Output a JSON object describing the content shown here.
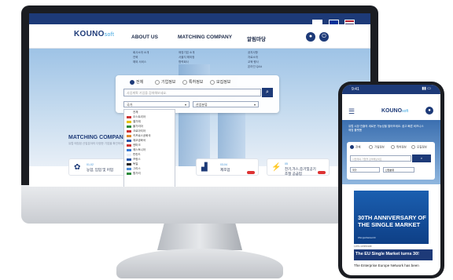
{
  "site": {
    "logo": "KOUNO",
    "logo_suffix": "soft",
    "nav": [
      "ABOUT US",
      "MATCHING COMPANY",
      "알림마당"
    ],
    "submenu_col1": [
      "회사소개 소개",
      "연혁",
      "해외 서비스"
    ],
    "submenu_col2": [
      "매칭기업 소개",
      "서울지 해외정",
      "협력회사"
    ],
    "submenu_col3": [
      "공지사항",
      "자료소개",
      "교육 행사",
      "온라인 Q&A"
    ],
    "search_tabs": [
      "전체",
      "기업정보",
      "특허정보",
      "모집정보"
    ],
    "search_placeholder": "사업계획 기업을 검색해보세요.",
    "search_icon_glyph": "⌕",
    "select_country": "국가",
    "select_industry": "산업분류",
    "dropdown_header": "전체",
    "dropdown_items": [
      "오스트리아",
      "벨기에",
      "불가리아",
      "크로아티아",
      "키프로스공화국",
      "체코공화국",
      "덴마크",
      "에스토니아",
      "핀란드",
      "프랑스",
      "독일",
      "그리스",
      "헝가리"
    ],
    "matching_title": "MATCHING COMPANY",
    "matching_sub": "유럽 매칭된 산업분야의 다양한 기업을 확인하세요.",
    "cards": [
      {
        "num": "01-02",
        "label": "농업, 임업 및 어업"
      },
      {
        "num": "03-04",
        "label": "제조업"
      },
      {
        "num": "05",
        "label": "전기,가스,증기및공기조절 공급업"
      }
    ],
    "user_icon": "user-icon",
    "logout_icon": "logout-icon"
  },
  "phone": {
    "time": "9:41",
    "hero_text": "유럽 시장 진출의 새로운 가능성을 열어보세요. 쉽고 빠른 비즈니스 매칭 플랫폼",
    "search_tabs": [
      "전체",
      "기업정보",
      "특허정보",
      "모집정보"
    ],
    "search_placeholder": "사업계획 기업을 검색해보세요.",
    "select_country": "국가",
    "select_industry": "산업분류",
    "banner_title": "30TH ANNIVERSARY OF THE SINGLE MARKET",
    "banner_tag": "#SingleMarket30",
    "kicker": "Let's celebrate",
    "headline": "The EU Single Market turns 30!",
    "body": "The Enterprise Europe Network has been"
  },
  "colors": {
    "brand": "#1d3a78",
    "accent": "#3aa4e0",
    "alert": "#dd3333"
  }
}
